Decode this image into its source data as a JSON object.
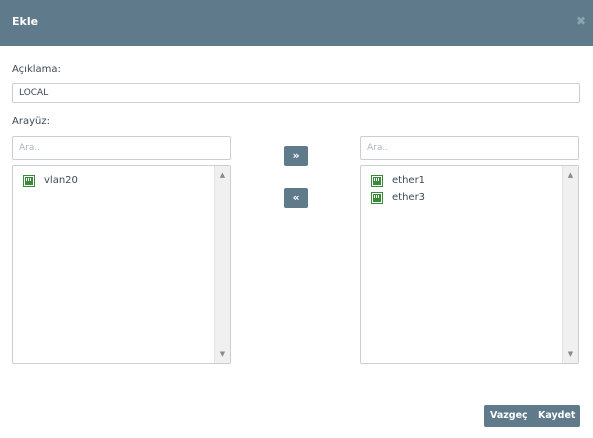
{
  "dialog": {
    "title": "Ekle",
    "close_glyph": "✖"
  },
  "form": {
    "description_label": "Açıklama:",
    "description_value": "LOCAL",
    "interface_label": "Arayüz:"
  },
  "available": {
    "search_placeholder": "Ara..",
    "items": [
      {
        "label": "vlan20",
        "icon": "network-port-icon"
      }
    ]
  },
  "selected": {
    "search_placeholder": "Ara..",
    "items": [
      {
        "label": "ether1",
        "icon": "network-port-icon"
      },
      {
        "label": "ether3",
        "icon": "network-port-icon"
      }
    ]
  },
  "transfer": {
    "add_glyph": "»",
    "remove_glyph": "«"
  },
  "scrollbar": {
    "up_glyph": "▲",
    "down_glyph": "▼"
  },
  "footer": {
    "cancel_label": "Vazgeç",
    "save_label": "Kaydet"
  },
  "colors": {
    "header": "#5f7b8b",
    "icon_green": "#3a8a3a"
  }
}
